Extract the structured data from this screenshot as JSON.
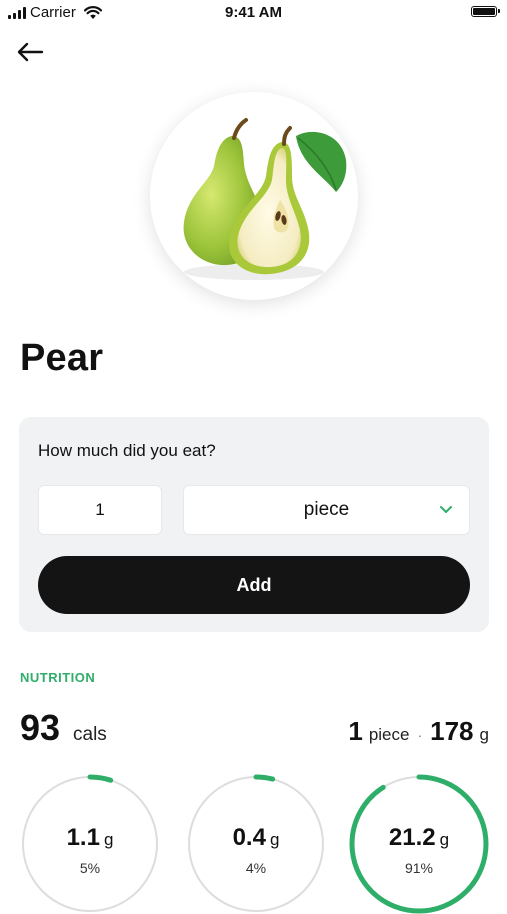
{
  "status_bar": {
    "carrier": "Carrier",
    "time": "9:41 AM"
  },
  "food": {
    "name": "Pear",
    "image_icon": "pear-image"
  },
  "portion": {
    "question": "How much did you eat?",
    "quantity": "1",
    "unit": "piece",
    "add_label": "Add"
  },
  "nutrition": {
    "section_label": "NUTRITION",
    "calories": "93",
    "calories_unit": "cals",
    "serving_qty": "1",
    "serving_unit": "piece",
    "serving_separator": "·",
    "serving_weight": "178",
    "serving_weight_unit": "g",
    "macros": [
      {
        "amount": "1.1",
        "unit": "g",
        "percent_label": "5%",
        "fraction": 0.05
      },
      {
        "amount": "0.4",
        "unit": "g",
        "percent_label": "4%",
        "fraction": 0.04
      },
      {
        "amount": "21.2",
        "unit": "g",
        "percent_label": "91%",
        "fraction": 0.91
      }
    ]
  },
  "colors": {
    "accent": "#2fae6a",
    "ring_track": "#dddddd",
    "button": "#141414",
    "card": "#f0f2f4"
  }
}
